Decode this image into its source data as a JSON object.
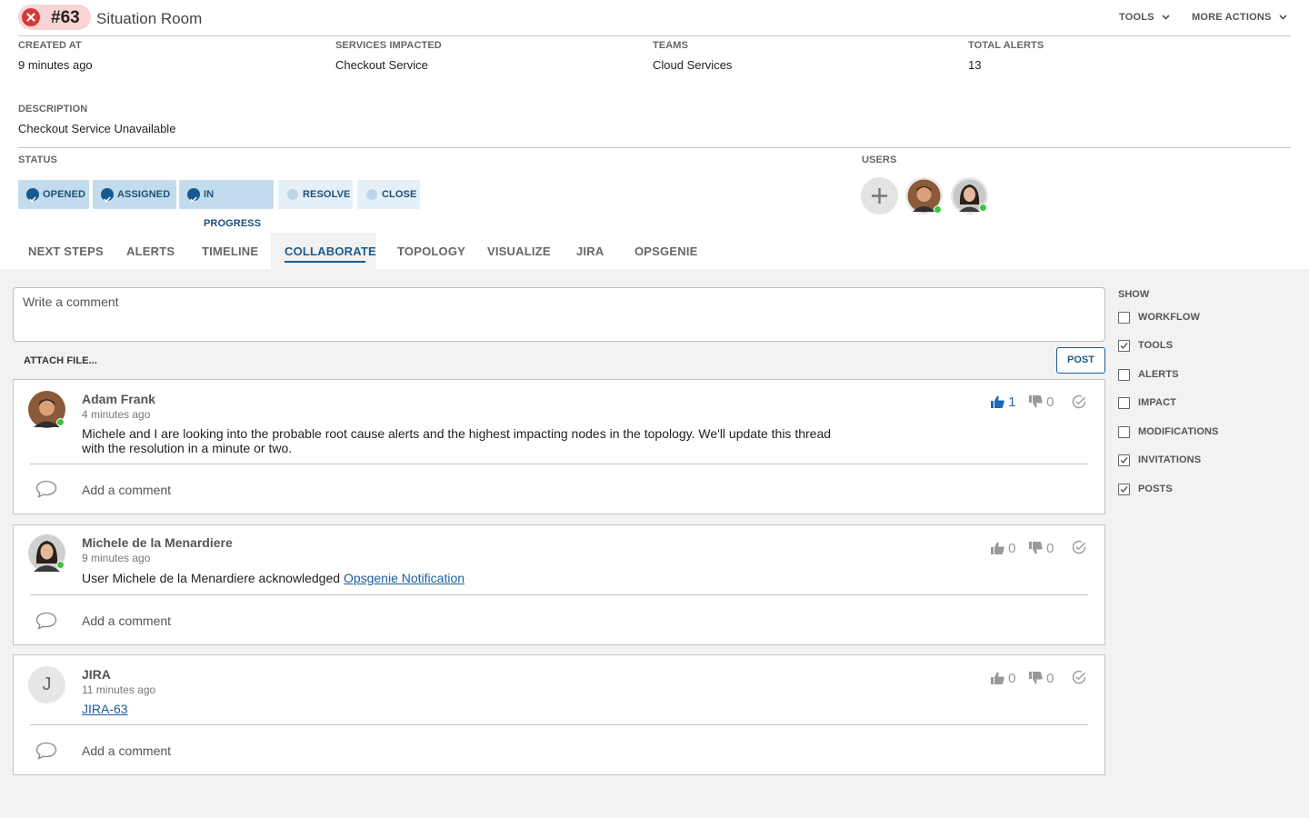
{
  "header": {
    "incident_number": "#63",
    "title": "Situation Room",
    "tools_label": "TOOLS",
    "more_actions_label": "MORE ACTIONS"
  },
  "meta": {
    "created_at_label": "CREATED AT",
    "created_at_value": "9 minutes ago",
    "services_label": "SERVICES IMPACTED",
    "services_value": "Checkout Service",
    "teams_label": "TEAMS",
    "teams_value": "Cloud Services",
    "total_alerts_label": "TOTAL ALERTS",
    "total_alerts_value": "13",
    "description_label": "DESCRIPTION",
    "description_value": "Checkout Service Unavailable"
  },
  "status": {
    "label": "STATUS",
    "steps": [
      {
        "label": "OPENED",
        "done": true
      },
      {
        "label": "ASSIGNED",
        "done": true
      },
      {
        "label": "IN PROGRESS",
        "done": true
      },
      {
        "label": "RESOLVE",
        "done": false
      },
      {
        "label": "CLOSE",
        "done": false
      }
    ]
  },
  "users": {
    "label": "USERS"
  },
  "tabs": [
    {
      "label": "NEXT STEPS"
    },
    {
      "label": "ALERTS"
    },
    {
      "label": "TIMELINE"
    },
    {
      "label": "COLLABORATE",
      "active": true
    },
    {
      "label": "TOPOLOGY"
    },
    {
      "label": "VISUALIZE"
    },
    {
      "label": "JIRA"
    },
    {
      "label": "OPSGENIE"
    }
  ],
  "composer": {
    "placeholder": "Write a comment",
    "attach_label": "ATTACH FILE...",
    "post_label": "POST"
  },
  "posts": [
    {
      "author": "Adam Frank",
      "time": "4 minutes ago",
      "body": "Michele and I are looking into the probable root cause alerts and the highest impacting nodes in the topology. We'll update this thread with the resolution in a minute or two.",
      "likes": "1",
      "dislikes": "0",
      "add_comment": "Add a comment"
    },
    {
      "author": "Michele de la Menardiere",
      "time": "9 minutes ago",
      "body_prefix": "User Michele de la Menardiere acknowledged ",
      "body_link": "Opsgenie Notification",
      "likes": "0",
      "dislikes": "0",
      "add_comment": "Add a comment"
    },
    {
      "author": "JIRA",
      "avatar_letter": "J",
      "time": "11 minutes ago",
      "body_link": "JIRA-63",
      "likes": "0",
      "dislikes": "0",
      "add_comment": "Add a comment"
    }
  ],
  "show": {
    "label": "SHOW",
    "options": [
      {
        "label": "WORKFLOW",
        "checked": false
      },
      {
        "label": "TOOLS",
        "checked": true
      },
      {
        "label": "ALERTS",
        "checked": false
      },
      {
        "label": "IMPACT",
        "checked": false
      },
      {
        "label": "MODIFICATIONS",
        "checked": false
      },
      {
        "label": "INVITATIONS",
        "checked": true
      },
      {
        "label": "POSTS",
        "checked": true
      }
    ]
  },
  "colors": {
    "accent": "#1d5a8f",
    "error": "#d33a3a",
    "presence": "#3ec43e"
  }
}
